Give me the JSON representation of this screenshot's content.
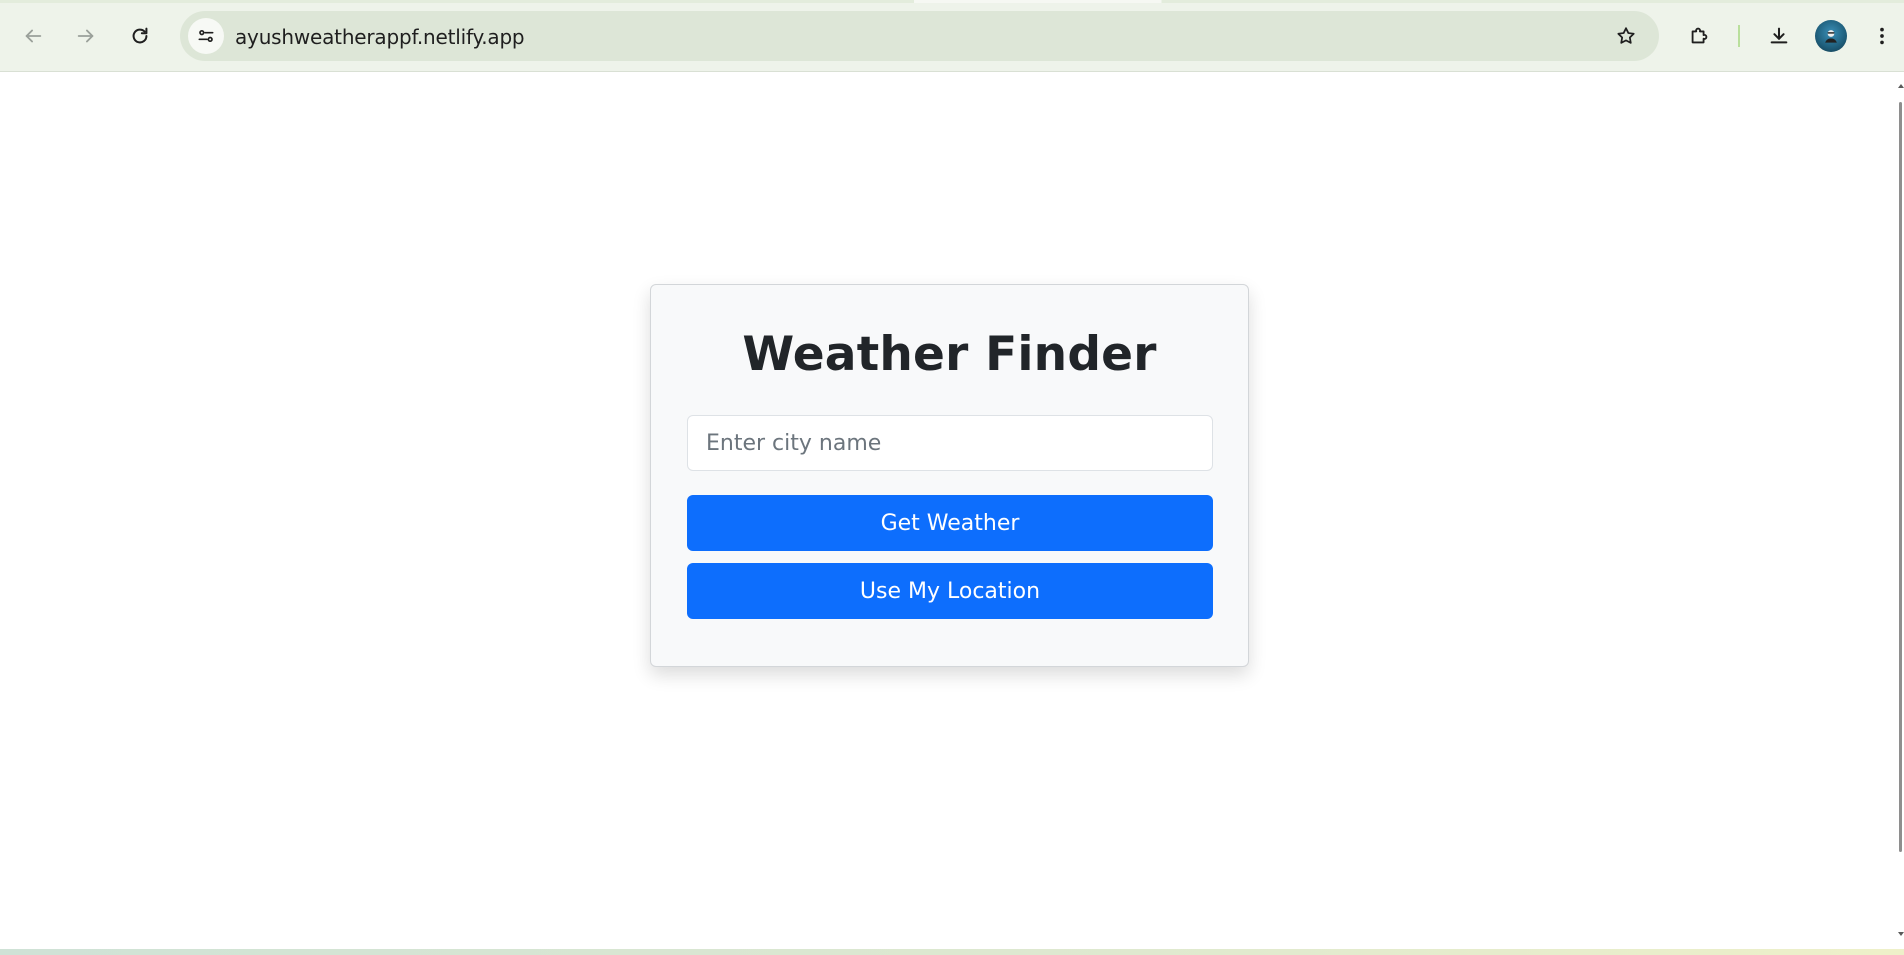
{
  "browser": {
    "url": "ayushweatherappf.netlify.app",
    "icons": {
      "back": "arrow-left-icon",
      "forward": "arrow-right-icon",
      "reload": "reload-icon",
      "site_info": "tune-icon",
      "bookmark": "star-icon",
      "extensions": "puzzle-icon",
      "downloads": "download-icon",
      "profile": "avatar",
      "menu": "kebab-menu-icon"
    },
    "accent_color": "#b9df9c"
  },
  "app": {
    "title": "Weather Finder",
    "city_input": {
      "placeholder": "Enter city name",
      "value": ""
    },
    "get_weather_label": "Get Weather",
    "use_location_label": "Use My Location",
    "colors": {
      "primary": "#0d6efd",
      "card_background": "#f8f9fa",
      "title_text": "#212529"
    }
  }
}
